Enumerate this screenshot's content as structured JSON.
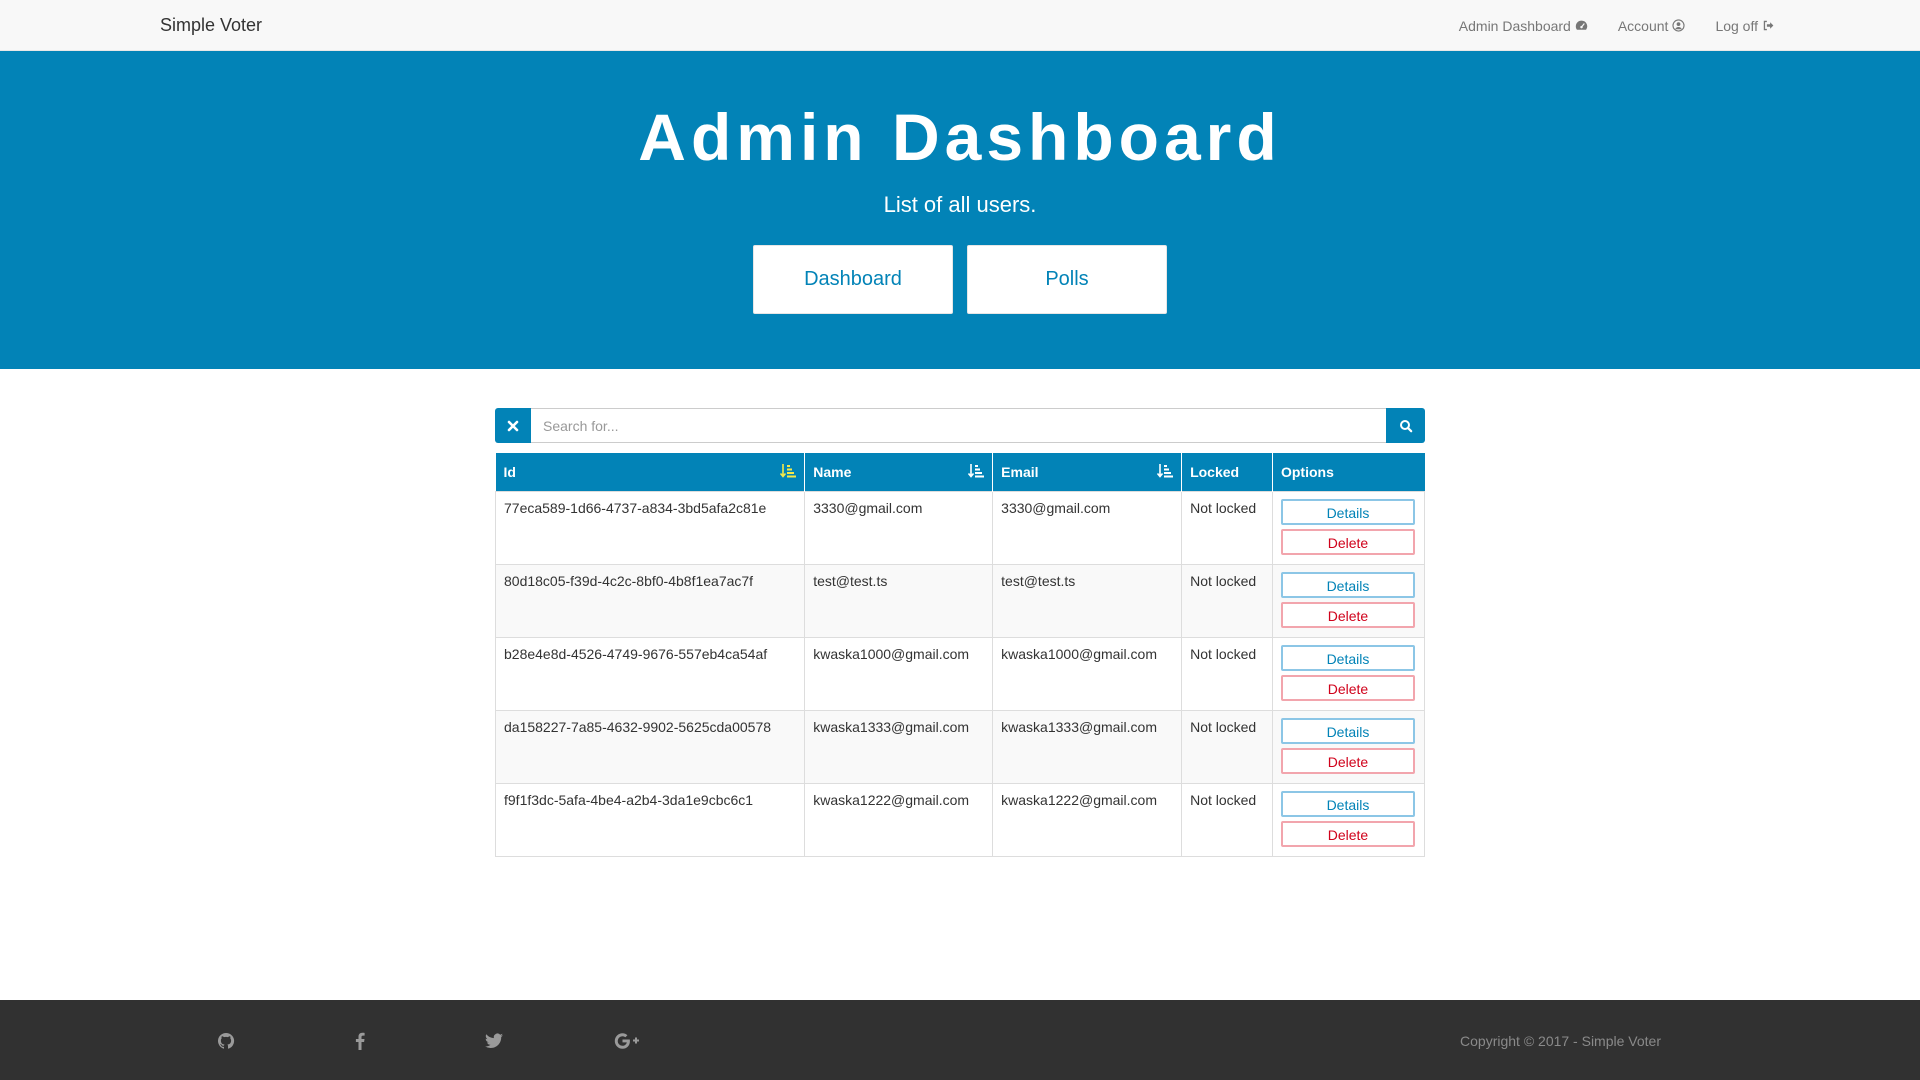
{
  "navbar": {
    "brand": "Simple Voter",
    "links": [
      {
        "label": "Admin Dashboard",
        "icon": "dashboard-icon"
      },
      {
        "label": "Account",
        "icon": "user-circle-icon"
      },
      {
        "label": "Log off",
        "icon": "sign-out-icon"
      }
    ]
  },
  "hero": {
    "title": "Admin Dashboard",
    "subtitle": "List of all users.",
    "buttons": [
      "Dashboard",
      "Polls"
    ]
  },
  "search": {
    "placeholder": "Search for...",
    "clear_icon": "close-icon",
    "go_icon": "search-icon"
  },
  "table": {
    "headers": [
      "Id",
      "Name",
      "Email",
      "Locked",
      "Options"
    ],
    "rows": [
      {
        "id": "77eca589-1d66-4737-a834-3bd5afa2c81e",
        "name": "3330@gmail.com",
        "email": "3330@gmail.com",
        "locked": "Not locked"
      },
      {
        "id": "80d18c05-f39d-4c2c-8bf0-4b8f1ea7ac7f",
        "name": "test@test.ts",
        "email": "test@test.ts",
        "locked": "Not locked"
      },
      {
        "id": "b28e4e8d-4526-4749-9676-557eb4ca54af",
        "name": "kwaska1000@gmail.com",
        "email": "kwaska1000@gmail.com",
        "locked": "Not locked"
      },
      {
        "id": "da158227-7a85-4632-9902-5625cda00578",
        "name": "kwaska1333@gmail.com",
        "email": "kwaska1333@gmail.com",
        "locked": "Not locked"
      },
      {
        "id": "f9f1f3dc-5afa-4be4-a2b4-3da1e9cbc6c1",
        "name": "kwaska1222@gmail.com",
        "email": "kwaska1222@gmail.com",
        "locked": "Not locked"
      }
    ],
    "details_label": "Details",
    "delete_label": "Delete"
  },
  "footer": {
    "icons": [
      "github-icon",
      "facebook-icon",
      "twitter-icon",
      "google-plus-icon"
    ],
    "copyright": "Copyright © 2017 - Simple Voter"
  },
  "colors": {
    "primary": "#0283b7",
    "navbar_bg": "#f8f8f8",
    "footer_bg": "#313131",
    "danger": "#d0021b",
    "active_sort": "#f5e94a"
  }
}
